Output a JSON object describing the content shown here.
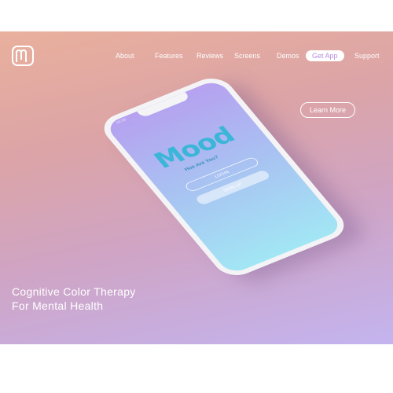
{
  "nav": {
    "items": [
      "About",
      "Features",
      "Reviews",
      "Screens",
      "Demos",
      "Get App",
      "Support"
    ]
  },
  "hero": {
    "cta_label": "Learn More",
    "headline_line1": "Cognitive Color Therapy",
    "headline_line2": "For Mental Health"
  },
  "phone": {
    "status_time": "10:18",
    "app_logo": "Mood",
    "tagline": "Hue Are You?",
    "login_label": "LOGIN",
    "signup_label": "SIGN UP"
  },
  "colors": {
    "gradient_top": "#e9b09d",
    "gradient_bottom": "#c3b4ef",
    "pill_text": "#b58de0",
    "app_accent": "#3bb6d8"
  },
  "icons": [
    "logo-m-icon"
  ]
}
